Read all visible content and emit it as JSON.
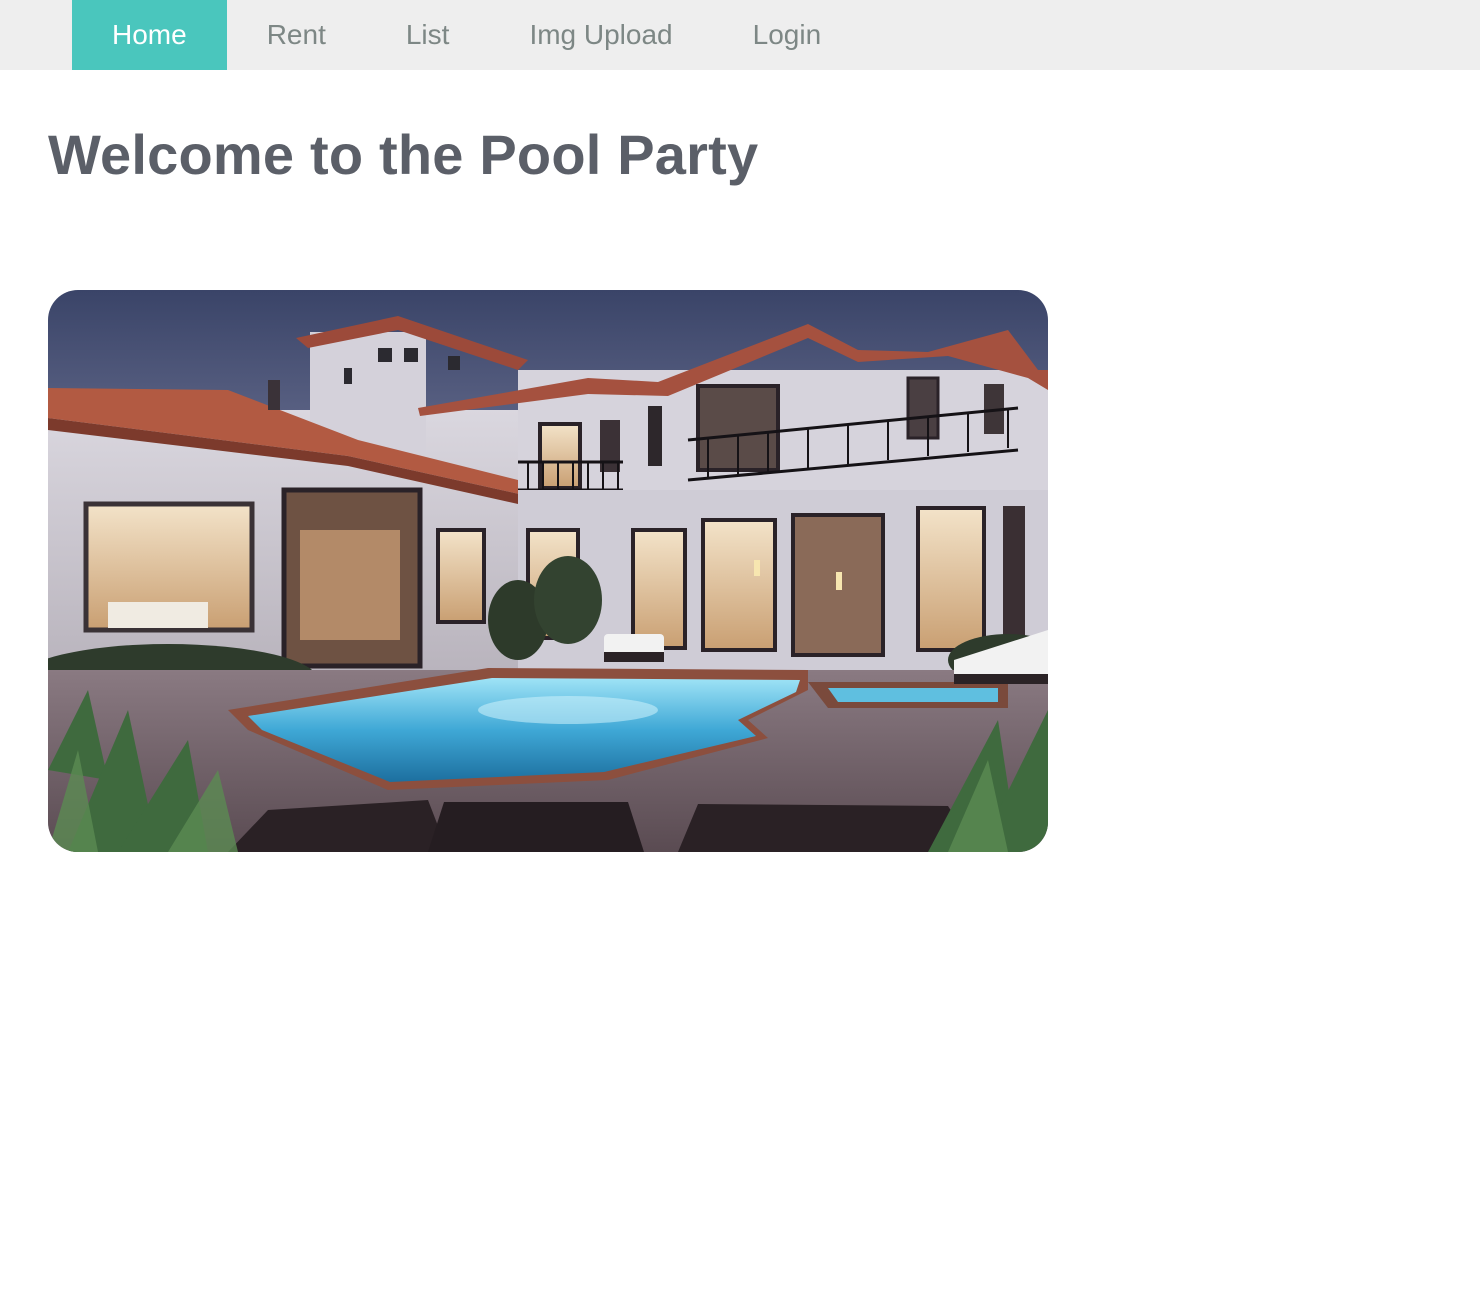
{
  "nav": {
    "items": [
      {
        "label": "Home",
        "active": true
      },
      {
        "label": "Rent",
        "active": false
      },
      {
        "label": "List",
        "active": false
      },
      {
        "label": "Img Upload",
        "active": false
      },
      {
        "label": "Login",
        "active": false
      }
    ]
  },
  "main": {
    "title": "Welcome to the Pool Party"
  },
  "colors": {
    "nav_bg": "#eeeeee",
    "nav_active": "#4ac6bd",
    "nav_text": "#7d8785",
    "title": "#5b5f68"
  }
}
